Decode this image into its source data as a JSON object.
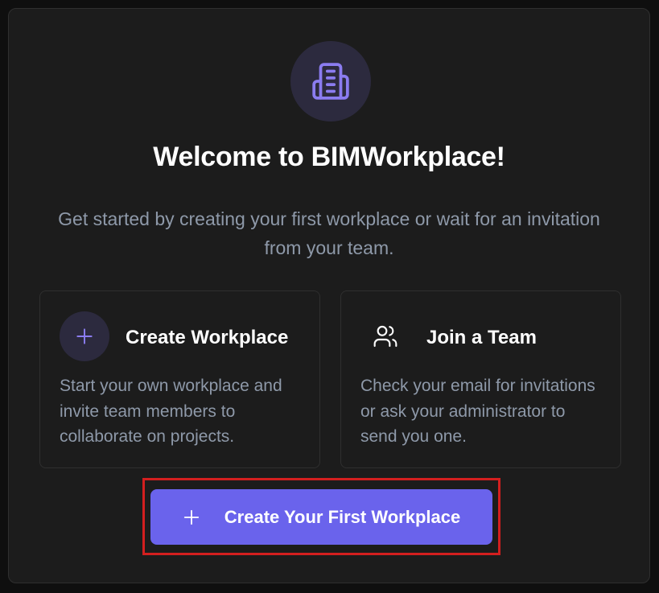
{
  "welcome": {
    "title": "Welcome to BIMWorkplace!",
    "subtitle": "Get started by creating your first workplace or wait for an invitation from your team."
  },
  "options": [
    {
      "title": "Create Workplace",
      "description": "Start your own workplace and invite team members to collaborate on projects.",
      "icon": "plus-icon"
    },
    {
      "title": "Join a Team",
      "description": "Check your email for invitations or ask your administrator to send you one.",
      "icon": "users-icon"
    }
  ],
  "cta": {
    "label": "Create Your First Workplace",
    "icon": "plus-icon"
  },
  "colors": {
    "background": "#1c1c1c",
    "accent": "#6a63ec",
    "icon_circle": "#2c2a3e",
    "muted_text": "#8e99a9",
    "highlight_border": "#d31f1f"
  }
}
